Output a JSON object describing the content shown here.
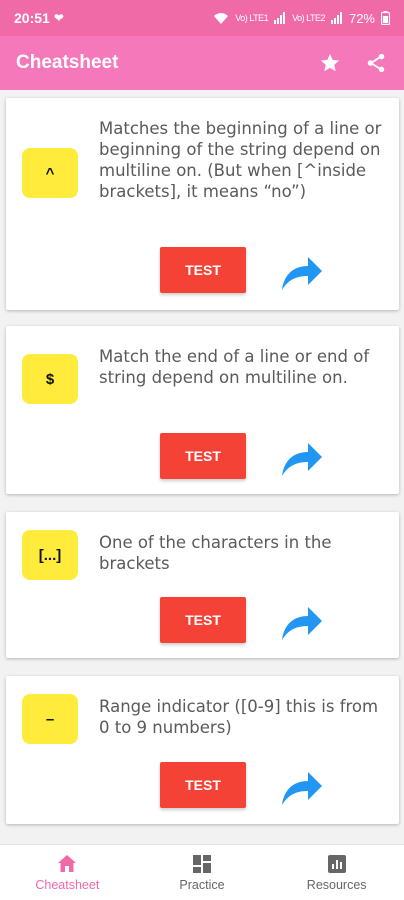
{
  "status_bar": {
    "time": "20:51",
    "battery": "72%",
    "signal_text_1": "Vo) LTE1",
    "signal_text_2": "Vo) LTE2"
  },
  "app_bar": {
    "title": "Cheatsheet",
    "icons": [
      "star-icon",
      "share-icon"
    ]
  },
  "cards": [
    {
      "symbol": "^",
      "description": "Matches the beginning of a line or beginning of the string depend on multiline on. (But when [^inside brackets], it means “no”)",
      "test_label": "TEST"
    },
    {
      "symbol": "$",
      "description": "Match the end of a line or end of string depend on multiline on.",
      "test_label": "TEST"
    },
    {
      "symbol": "[...]",
      "description": "One of the characters in the brackets",
      "test_label": "TEST"
    },
    {
      "symbol": "–",
      "description": "Range indicator ([0-9] this is from 0 to 9 numbers)",
      "test_label": "TEST"
    }
  ],
  "bottom_nav": {
    "items": [
      {
        "label": "Cheatsheet",
        "icon": "home-icon",
        "active": true
      },
      {
        "label": "Practice",
        "icon": "grid-icon",
        "active": false
      },
      {
        "label": "Resources",
        "icon": "chart-icon",
        "active": false
      }
    ]
  },
  "colors": {
    "status_bar": "#f06aa8",
    "app_bar": "#f578ba",
    "symbol_bg": "#ffeb3b",
    "test_button": "#f44336",
    "share_arrow": "#2196f3",
    "active_nav": "#f06aa8"
  }
}
